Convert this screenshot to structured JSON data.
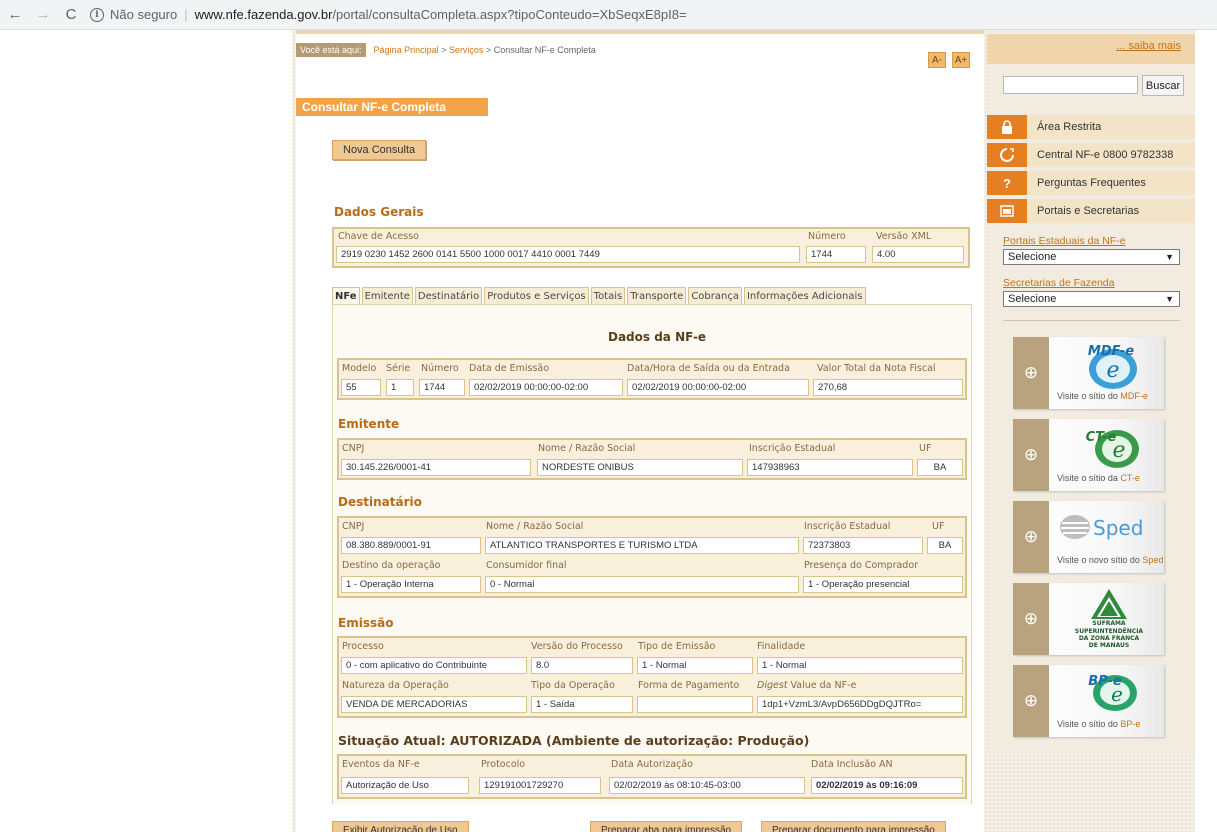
{
  "browser": {
    "not_secure_label": "Não seguro",
    "url_host": "www.nfe.fazenda.gov.br",
    "url_path": "/portal/consultaCompleta.aspx?tipoConteudo=XbSeqxE8pI8="
  },
  "breadcrumb": {
    "label": "Você está aqui:",
    "home": "Página Principal",
    "sep1": ">",
    "services": "Serviços",
    "sep2": ">",
    "current": "Consultar NF-e Completa"
  },
  "font_controls": {
    "decrease": "A-",
    "increase": "A+"
  },
  "page_title": "Consultar NF-e Completa",
  "new_query_label": "Nova Consulta",
  "dados_gerais": {
    "title": "Dados Gerais",
    "chave_label": "Chave de Acesso",
    "chave_value": "2919 0230 1452 2600 0141 5500 1000 0017 4410 0001 7449",
    "numero_label": "Número",
    "numero_value": "1744",
    "versao_label": "Versão XML",
    "versao_value": "4.00"
  },
  "tabs": [
    "NFe",
    "Emitente",
    "Destinatário",
    "Produtos e Serviços",
    "Totais",
    "Transporte",
    "Cobrança",
    "Informações Adicionais"
  ],
  "nfe": {
    "title": "Dados da NF-e",
    "labels": {
      "modelo": "Modelo",
      "serie": "Série",
      "numero": "Número",
      "emissao": "Data de Emissão",
      "saida": "Data/Hora de Saída ou da Entrada",
      "total": "Valor Total da Nota Fiscal"
    },
    "values": {
      "modelo": "55",
      "serie": "1",
      "numero": "1744",
      "emissao": "02/02/2019 00:00:00-02:00",
      "saida": "02/02/2019 00:00:00-02:00",
      "total": "270,68"
    }
  },
  "emitente": {
    "title": "Emitente",
    "labels": {
      "cnpj": "CNPJ",
      "nome": "Nome / Razão Social",
      "ie": "Inscrição Estadual",
      "uf": "UF"
    },
    "values": {
      "cnpj": "30.145.226/0001-41",
      "nome": "NORDESTE ONIBUS",
      "ie": "147938963",
      "uf": "BA"
    }
  },
  "destinatario": {
    "title": "Destinatário",
    "labels": {
      "cnpj": "CNPJ",
      "nome": "Nome / Razão Social",
      "ie": "Inscrição Estadual",
      "uf": "UF",
      "destino": "Destino da operação",
      "consumidor": "Consumidor final",
      "presenca": "Presença do Comprador"
    },
    "values": {
      "cnpj": "08.380.889/0001-91",
      "nome": "ATLANTICO TRANSPORTES E TURISMO LTDA",
      "ie": "72373803",
      "uf": "BA",
      "destino": "1 - Operação Interna",
      "consumidor": "0 - Normal",
      "presenca": "1 - Operação presencial"
    }
  },
  "emissao": {
    "title": "Emissão",
    "labels": {
      "processo": "Processo",
      "versao": "Versão do Processo",
      "tipo_emissao": "Tipo de Emissão",
      "finalidade": "Finalidade",
      "natureza": "Natureza da Operação",
      "tipo_operacao": "Tipo da Operação",
      "forma_pagamento": "Forma de Pagamento",
      "digest_em": "Digest",
      "digest_rest": " Value da NF-e"
    },
    "values": {
      "processo": "0 - com aplicativo do Contribuinte",
      "versao": "8.0",
      "tipo_emissao": "1 - Normal",
      "finalidade": "1 - Normal",
      "natureza": "VENDA DE MERCADORIAS",
      "tipo_operacao": "1 - Saída",
      "forma_pagamento": "",
      "digest": "1dp1+VzmL3/AvpD656DDgDQJTRo="
    }
  },
  "situacao": {
    "title": "Situação Atual: AUTORIZADA (Ambiente de autorização: Produção)",
    "labels": {
      "eventos": "Eventos da NF-e",
      "protocolo": "Protocolo",
      "data_aut": "Data Autorização",
      "data_an": "Data Inclusão AN"
    },
    "values": {
      "eventos": "Autorização de Uso",
      "protocolo": "129191001729270",
      "data_aut": "02/02/2019 às 08:10:45-03:00",
      "data_an": "02/02/2019 às 09:16:09"
    }
  },
  "bottom_buttons": [
    "Exibir Autorização de Uso",
    "Preparar aba para impressão",
    "Preparar documento para impressão"
  ],
  "sidebar": {
    "saiba_mais": "... saiba mais",
    "search_button": "Buscar",
    "items": [
      {
        "label": "Área Restrita",
        "icon": "lock-icon",
        "glyph": "🔒"
      },
      {
        "label": "Central NF-e 0800 9782338",
        "icon": "phone-icon",
        "glyph": "☎"
      },
      {
        "label": "Perguntas Frequentes",
        "icon": "question-icon",
        "glyph": "?"
      },
      {
        "label": "Portais e Secretarias",
        "icon": "portal-icon",
        "glyph": "▣"
      }
    ],
    "portais_label": "Portais Estaduais da NF-e",
    "portais_value": "Selecione",
    "secretarias_label": "Secretarias de Fazenda",
    "secretarias_value": "Selecione",
    "banners": [
      {
        "logo": "MDF-e",
        "cap1": "Visite o sítio do ",
        "cap_hl": "MDF-e"
      },
      {
        "logo": "CT-e",
        "cap1": "Visite o sítio da ",
        "cap_hl": "CT-e"
      },
      {
        "logo": "Sped",
        "cap1": "Visite o novo sítio do ",
        "cap_hl": "Sped"
      },
      {
        "logo_lines": [
          "SUFRAMA",
          "SUPERINTENDÊNCIA",
          "DA ZONA FRANCA",
          "DE MANAUS"
        ],
        "cap1": "",
        "cap_hl": ""
      },
      {
        "logo": "BP-e",
        "cap1": "Visite o sítio do ",
        "cap_hl": "BP-e"
      }
    ]
  },
  "colors": {
    "accent": "#f2a44a",
    "section_title": "#b86b1a",
    "box_bg": "#f8f0dc",
    "box_border": "#d9c48e",
    "sidebar_icon": "#e67e22"
  }
}
